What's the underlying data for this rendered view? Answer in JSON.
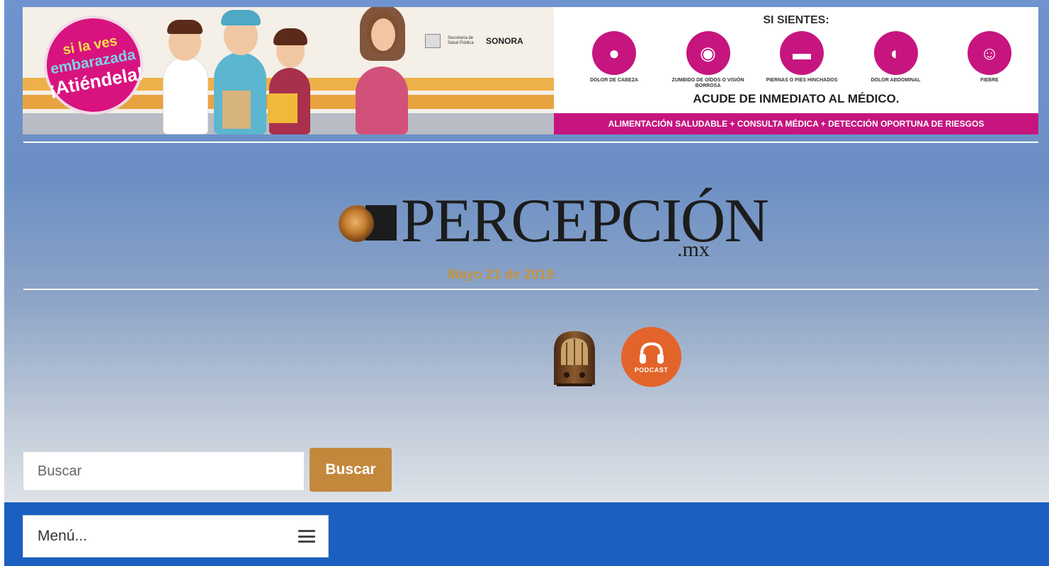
{
  "banner": {
    "badge_line1": "si la ves",
    "badge_line2": "embarazada",
    "badge_line3": "¡Atiéndela!",
    "agency_text": "Secretaría de Salud Pública",
    "state_text": "SONORA",
    "si_sientes": "SI SIENTES:",
    "symptoms": [
      {
        "label": "DOLOR DE CABEZA",
        "icon": "head-icon"
      },
      {
        "label": "ZUMBIDO DE OÍDOS O VISIÓN BORROSA",
        "icon": "ear-eye-icon"
      },
      {
        "label": "PIERNAS O PIES HINCHADOS",
        "icon": "foot-icon"
      },
      {
        "label": "DOLOR ABDOMINAL",
        "icon": "abdomen-icon"
      },
      {
        "label": "FIEBRE",
        "icon": "fever-icon"
      }
    ],
    "acude": "ACUDE DE INMEDIATO AL MÉDICO.",
    "footer": "ALIMENTACIÓN SALUDABLE + CONSULTA MÉDICA + DETECCIÓN OPORTUNA DE RIESGOS",
    "colors": {
      "magenta": "#c6157f",
      "orange": "#eeb04a"
    }
  },
  "logo": {
    "name": "PERCEPCIÓN",
    "suffix": ".mx"
  },
  "date": "Mayo 21 de 2019",
  "media": {
    "radio_icon": "vintage-radio-icon",
    "podcast_label": "PODCAST"
  },
  "search": {
    "placeholder": "Buscar",
    "value": "",
    "button_label": "Buscar"
  },
  "nav": {
    "menu_label": "Menú...",
    "background": "#1b5fc1"
  }
}
